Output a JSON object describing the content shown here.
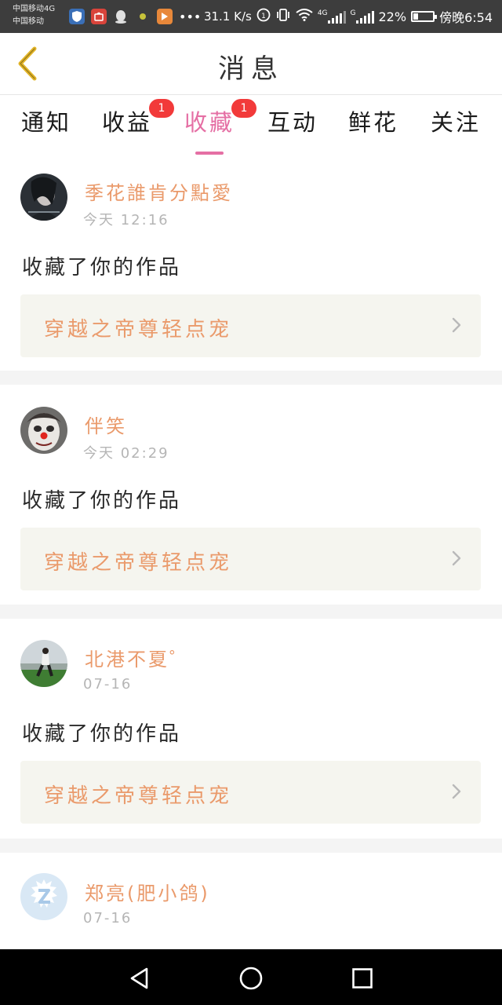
{
  "status_bar": {
    "carrier_1": "中国移动4G",
    "carrier_2": "中国移动",
    "net_speed": "31.1 K/s",
    "network_type": "4G",
    "signal_type": "G",
    "battery": "22%",
    "time": "傍晚6:54"
  },
  "header": {
    "title": "消息",
    "back_icon": "chevron-left-icon",
    "back_color": "#e2b427"
  },
  "tabs": [
    {
      "label": "通知",
      "badge": ""
    },
    {
      "label": "收益",
      "badge": "1"
    },
    {
      "label": "收藏",
      "badge": "1",
      "active": true
    },
    {
      "label": "互动",
      "badge": ""
    },
    {
      "label": "鲜花",
      "badge": ""
    },
    {
      "label": "关注",
      "badge": ""
    }
  ],
  "colors": {
    "accent": "#e56fa4",
    "username": "#ea9a6b",
    "badge": "#f23a3a"
  },
  "notifications": [
    {
      "user": "季花誰肯分點愛",
      "time": "今天 12:16",
      "action": "收藏了你的作品",
      "work": "穿越之帝尊轻点宠"
    },
    {
      "user": "伴笑",
      "time": "今天 02:29",
      "action": "收藏了你的作品",
      "work": "穿越之帝尊轻点宠"
    },
    {
      "user": "北港不夏゜",
      "time": "07-16",
      "action": "收藏了你的作品",
      "work": "穿越之帝尊轻点宠"
    },
    {
      "user": "郑亮(肥小鸽)",
      "time": "07-16"
    }
  ],
  "nav": {
    "back": "triangle-back-icon",
    "home": "circle-home-icon",
    "recents": "square-recents-icon"
  }
}
